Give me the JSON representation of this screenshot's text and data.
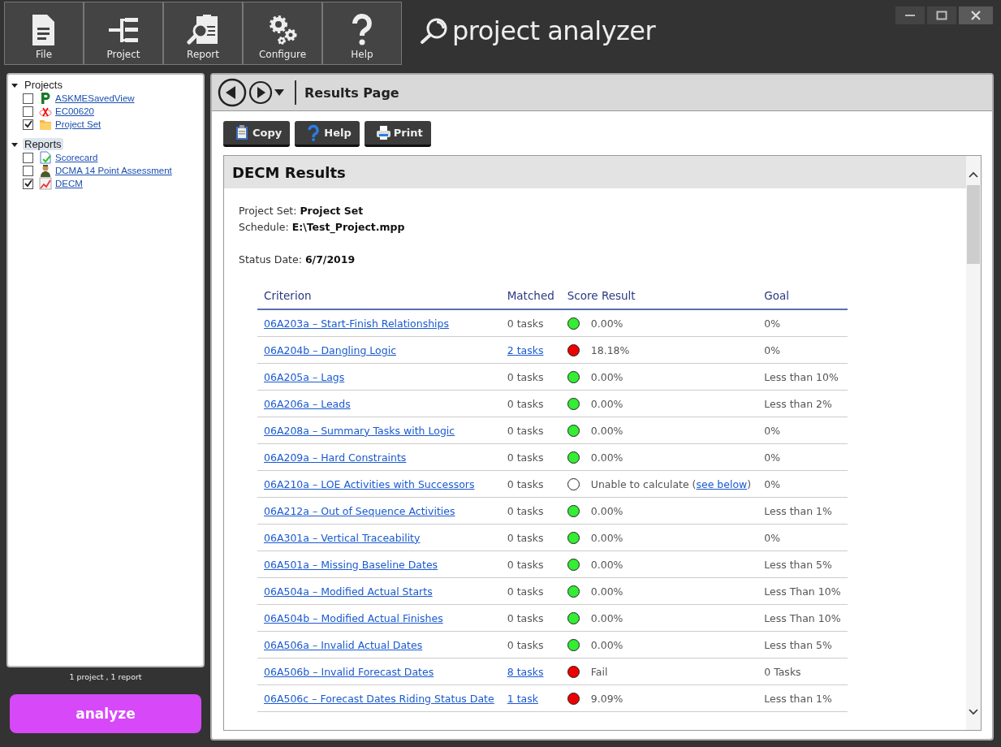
{
  "toolbar": [
    {
      "label": "File"
    },
    {
      "label": "Project"
    },
    {
      "label": "Report"
    },
    {
      "label": "Configure"
    },
    {
      "label": "Help"
    }
  ],
  "app_title": "project analyzer",
  "sidebar": {
    "groups": [
      {
        "label": "Projects",
        "expanded": true,
        "selected": false,
        "children": [
          {
            "label": "ASKMESavedView",
            "checked": false
          },
          {
            "label": "EC00620",
            "checked": false
          },
          {
            "label": "Project Set",
            "checked": true
          }
        ]
      },
      {
        "label": "Reports",
        "expanded": true,
        "selected": true,
        "children": [
          {
            "label": "Scorecard",
            "checked": false
          },
          {
            "label": "DCMA 14 Point Assessment",
            "checked": false
          },
          {
            "label": "DECM",
            "checked": true
          }
        ]
      }
    ],
    "summary": "1 project , 1 report",
    "action": "analyze"
  },
  "page": {
    "title": "Results Page",
    "buttons": [
      {
        "label": "Copy"
      },
      {
        "label": "Help"
      },
      {
        "label": "Print"
      }
    ],
    "report": {
      "title": "DECM Results",
      "info_groups": [
        [
          {
            "label": "Project Set: ",
            "value": "Project Set"
          },
          {
            "label": "Schedule: ",
            "value": "E:\\Test_Project.mpp"
          }
        ],
        [
          {
            "label": "Status Date: ",
            "value": "6/7/2019"
          }
        ]
      ],
      "columns": [
        "Criterion",
        "Matched",
        "Score Result",
        "Goal"
      ],
      "rows": [
        {
          "criterion": "06A203a – Start-Finish Relationships",
          "matched": "0 tasks",
          "matched_link": false,
          "color": "#33ee33",
          "score": "0.00%",
          "goal": "0%"
        },
        {
          "criterion": "06A204b – Dangling Logic",
          "matched": "2 tasks",
          "matched_link": true,
          "color": "#ee0000",
          "score": "18.18%",
          "goal": "0%"
        },
        {
          "criterion": "06A205a – Lags",
          "matched": "0 tasks",
          "matched_link": false,
          "color": "#33ee33",
          "score": "0.00%",
          "goal": "Less than 10%"
        },
        {
          "criterion": "06A206a – Leads",
          "matched": "0 tasks",
          "matched_link": false,
          "color": "#33ee33",
          "score": "0.00%",
          "goal": "Less than 2%"
        },
        {
          "criterion": "06A208a – Summary Tasks with Logic",
          "matched": "0 tasks",
          "matched_link": false,
          "color": "#33ee33",
          "score": "0.00%",
          "goal": "0%"
        },
        {
          "criterion": "06A209a – Hard Constraints",
          "matched": "0 tasks",
          "matched_link": false,
          "color": "#33ee33",
          "score": "0.00%",
          "goal": "0%"
        },
        {
          "criterion": "06A210a – LOE Activities with Successors",
          "matched": "0 tasks",
          "matched_link": false,
          "color": "#ffffff",
          "score": "Unable to calculate (",
          "score_link": "see below",
          "score_after": ")",
          "goal": "0%"
        },
        {
          "criterion": "06A212a – Out of Sequence Activities",
          "matched": "0 tasks",
          "matched_link": false,
          "color": "#33ee33",
          "score": "0.00%",
          "goal": "Less than 1%"
        },
        {
          "criterion": "06A301a – Vertical Traceability",
          "matched": "0 tasks",
          "matched_link": false,
          "color": "#33ee33",
          "score": "0.00%",
          "goal": "0%"
        },
        {
          "criterion": "06A501a – Missing Baseline Dates",
          "matched": "0 tasks",
          "matched_link": false,
          "color": "#33ee33",
          "score": "0.00%",
          "goal": "Less than 5%"
        },
        {
          "criterion": "06A504a – Modified Actual Starts",
          "matched": "0 tasks",
          "matched_link": false,
          "color": "#33ee33",
          "score": "0.00%",
          "goal": "Less Than 10%"
        },
        {
          "criterion": "06A504b – Modified Actual Finishes",
          "matched": "0 tasks",
          "matched_link": false,
          "color": "#33ee33",
          "score": "0.00%",
          "goal": "Less Than 10%"
        },
        {
          "criterion": "06A506a – Invalid Actual Dates",
          "matched": "0 tasks",
          "matched_link": false,
          "color": "#33ee33",
          "score": "0.00%",
          "goal": "Less than 5%"
        },
        {
          "criterion": "06A506b – Invalid Forecast Dates",
          "matched": "8 tasks",
          "matched_link": true,
          "color": "#ee0000",
          "score": "Fail",
          "goal": "0 Tasks"
        },
        {
          "criterion": "06A506c – Forecast Dates Riding Status Date",
          "matched": "1 task",
          "matched_link": true,
          "color": "#ee0000",
          "score": "9.09%",
          "goal": "Less than 1%"
        }
      ]
    }
  }
}
